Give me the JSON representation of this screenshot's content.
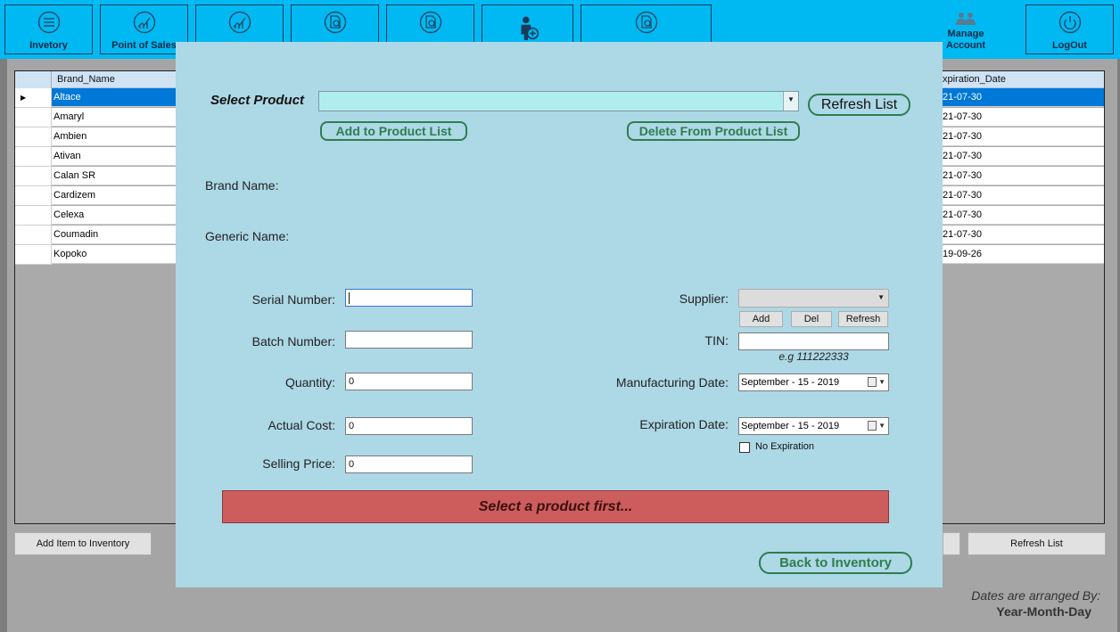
{
  "nav": {
    "inventory": "Invetory",
    "pos": "Point of Sales",
    "manage": "Manage Account",
    "logout": "LogOut"
  },
  "grid": {
    "col_brand": "Brand_Name",
    "col_expiration": "xpiration_Date",
    "rows": [
      {
        "brand": "Altace",
        "exp": "21-07-30"
      },
      {
        "brand": "Amaryl",
        "exp": "21-07-30"
      },
      {
        "brand": "Ambien",
        "exp": "21-07-30"
      },
      {
        "brand": "Ativan",
        "exp": "21-07-30"
      },
      {
        "brand": "Calan SR",
        "exp": "21-07-30"
      },
      {
        "brand": "Cardizem",
        "exp": "21-07-30"
      },
      {
        "brand": "Celexa",
        "exp": "21-07-30"
      },
      {
        "brand": "Coumadin",
        "exp": "21-07-30"
      },
      {
        "brand": "Kopoko",
        "exp": "19-09-26"
      }
    ]
  },
  "bottom": {
    "add_item": "Add Item to Inventory",
    "refresh": "Refresh List",
    "note1": "Dates are arranged By:",
    "note2": "Year-Month-Day"
  },
  "dialog": {
    "select_product": "Select Product",
    "refresh_list": "Refresh List",
    "add_to_list": "Add to Product List",
    "delete_from_list": "Delete From Product List",
    "brand_name": "Brand Name:",
    "generic_name": "Generic Name:",
    "serial_number": "Serial Number:",
    "batch_number": "Batch Number:",
    "quantity": "Quantity:",
    "actual_cost": "Actual Cost:",
    "selling_price": "Selling Price:",
    "quantity_value": "0",
    "actual_cost_value": "0",
    "selling_price_value": "0",
    "supplier": "Supplier:",
    "add": "Add",
    "del": "Del",
    "refresh": "Refresh",
    "tin": "TIN:",
    "tin_hint": "e.g 111222333",
    "manufacturing_date": "Manufacturing Date:",
    "manufacturing_date_value": "September - 15 - 2019",
    "expiration_date": "Expiration Date:",
    "expiration_date_value": "September - 15 - 2019",
    "no_expiration": "No Expiration",
    "warning": "Select a product first...",
    "back": "Back to Inventory"
  },
  "colors": {
    "topbar": "#00b9f2",
    "dialog_bg": "#add8e6",
    "pill_green": "#2e7d4f",
    "warning_bg": "#cd5c5c",
    "selection": "#0078d7"
  }
}
